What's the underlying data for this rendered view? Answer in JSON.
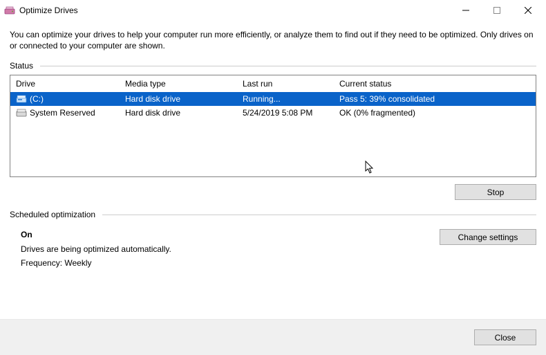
{
  "window": {
    "title": "Optimize Drives"
  },
  "intro": "You can optimize your drives to help your computer run more efficiently, or analyze them to find out if they need to be optimized. Only drives on or connected to your computer are shown.",
  "status_label": "Status",
  "columns": {
    "drive": "Drive",
    "media": "Media type",
    "lastrun": "Last run",
    "status": "Current status"
  },
  "rows": [
    {
      "drive": "(C:)",
      "media": "Hard disk drive",
      "lastrun": "Running...",
      "status": "Pass 5: 39% consolidated",
      "selected": true,
      "icon": "drive-c"
    },
    {
      "drive": "System Reserved",
      "media": "Hard disk drive",
      "lastrun": "5/24/2019 5:08 PM",
      "status": "OK (0% fragmented)",
      "selected": false,
      "icon": "drive-sys"
    }
  ],
  "buttons": {
    "stop": "Stop",
    "change_settings": "Change settings",
    "close": "Close"
  },
  "scheduled": {
    "label": "Scheduled optimization",
    "on": "On",
    "desc": "Drives are being optimized automatically.",
    "freq": "Frequency: Weekly"
  }
}
